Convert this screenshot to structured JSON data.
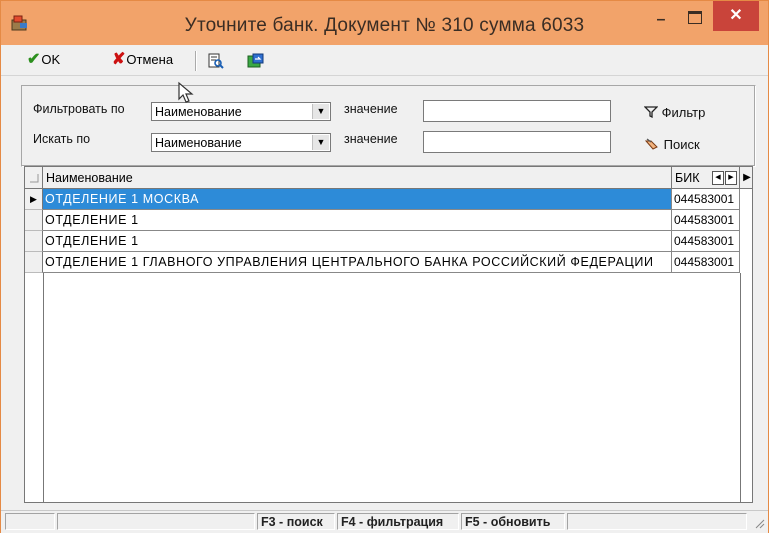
{
  "window": {
    "title": "Уточните банк. Документ № 310 сумма 6033",
    "minimize_glyph": "–",
    "close_glyph": "✕"
  },
  "toolbar": {
    "ok_icon": "✔",
    "ok_label": "OK",
    "cancel_icon": "✘",
    "cancel_label": "Отмена"
  },
  "filter": {
    "filter_by_label": "Фильтровать по",
    "filter_by_value": "Наименование",
    "filter_value_label": "значение",
    "filter_value": "",
    "filter_button": "Фильтр",
    "search_by_label": "Искать по",
    "search_by_value": "Наименование",
    "search_value_label": "значение",
    "search_value": "",
    "search_button": "Поиск"
  },
  "grid": {
    "columns": [
      "Наименование",
      "БИК"
    ],
    "current_row_marker": "▶",
    "rows": [
      {
        "name": "ОТДЕЛЕНИЕ 1 МОСКВА",
        "bik": "044583001"
      },
      {
        "name": "ОТДЕЛЕНИЕ 1",
        "bik": "044583001"
      },
      {
        "name": "ОТДЕЛЕНИЕ 1",
        "bik": "044583001"
      },
      {
        "name": "ОТДЕЛЕНИЕ 1 ГЛАВНОГО УПРАВЛЕНИЯ ЦЕНТРАЛЬНОГО БАНКА РОССИЙСКИЙ ФЕДЕРАЦИИ",
        "bik": "044583001"
      }
    ]
  },
  "statusbar": {
    "hint_search": "F3 - поиск",
    "hint_filter": "F4 - фильтрация",
    "hint_refresh": "F5 - обновить"
  },
  "colors": {
    "titlebar": "#f2a36a",
    "selection": "#2d8bd8",
    "close": "#c9443a"
  }
}
